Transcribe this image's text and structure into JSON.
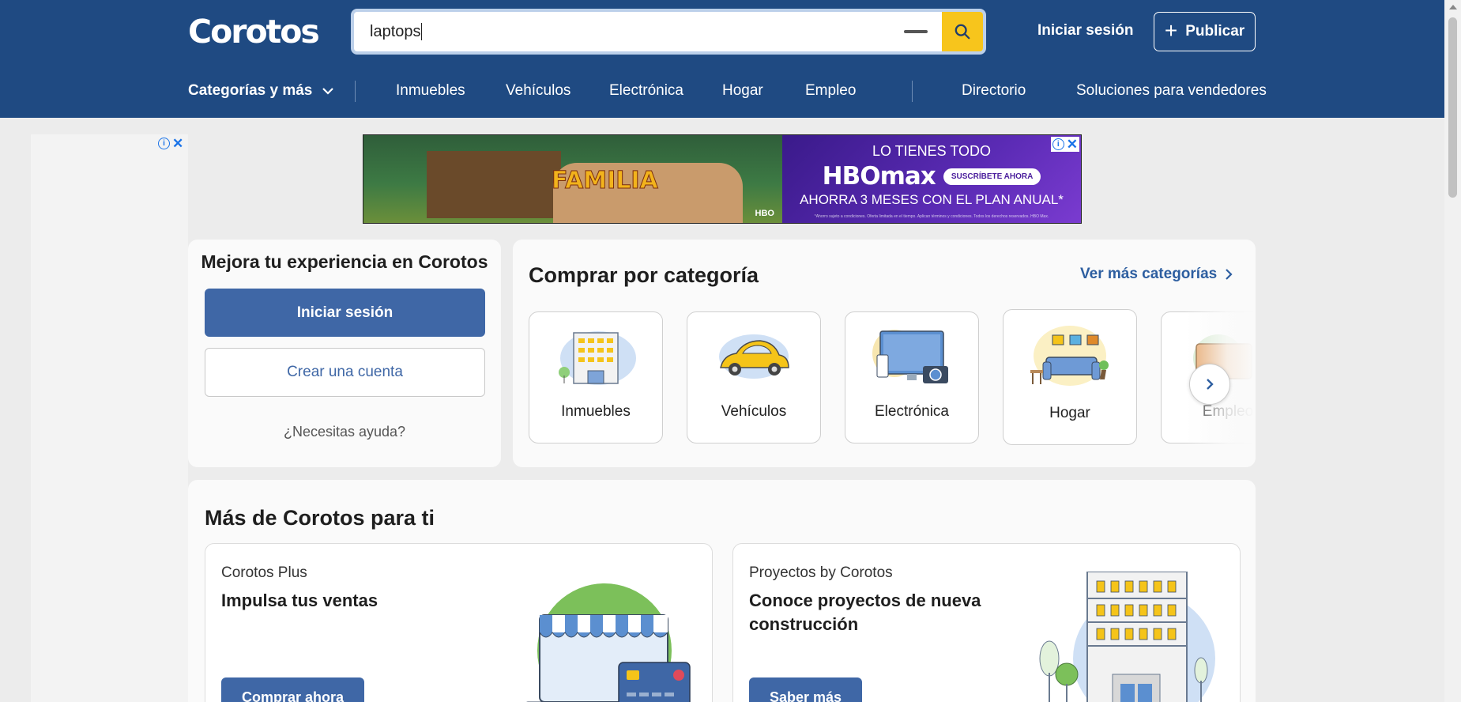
{
  "header": {
    "logo": "Corotos",
    "search": {
      "value": "laptops"
    },
    "login_label": "Iniciar sesión",
    "publish_label": "Publicar",
    "categories_menu_label": "Categorías y más",
    "nav_items": [
      "Inmuebles",
      "Vehículos",
      "Electrónica",
      "Hogar",
      "Empleo"
    ],
    "right_links": [
      "Directorio",
      "Soluciones para vendedores"
    ]
  },
  "ad_banner": {
    "left_title": "FAMILIA",
    "left_brand": "HBO",
    "line1": "LO TIENES TODO",
    "brand": "HBOmax",
    "cta": "SUSCRÍBETE AHORA",
    "line3": "AHORRA 3 MESES CON EL PLAN ANUAL*",
    "fine_print": "*Ahorro sujeto a condiciones. Oferta limitada en el tiempo. Aplican términos y condiciones. Todos los derechos reservados. HBO Max."
  },
  "login_card": {
    "title": "Mejora tu experiencia en Corotos",
    "login_button": "Iniciar sesión",
    "register_button": "Crear una cuenta",
    "help_link": "¿Necesitas ayuda?"
  },
  "categories": {
    "title": "Comprar por categoría",
    "more_link": "Ver más categorías",
    "items": [
      {
        "label": "Inmuebles",
        "icon": "building-icon"
      },
      {
        "label": "Vehículos",
        "icon": "car-icon"
      },
      {
        "label": "Electrónica",
        "icon": "electronics-icon"
      },
      {
        "label": "Hogar",
        "icon": "sofa-icon"
      },
      {
        "label": "Empleo",
        "icon": "briefcase-icon"
      }
    ]
  },
  "more_section": {
    "title": "Más de Corotos para ti",
    "promos": [
      {
        "kicker": "Corotos Plus",
        "headline": "Impulsa tus ventas",
        "cta": "Comprar ahora",
        "icon": "storefront-laptop-icon"
      },
      {
        "kicker": "Proyectos by Corotos",
        "headline": "Conoce proyectos de nueva construcción",
        "cta": "Saber más",
        "icon": "apartment-building-icon"
      }
    ]
  },
  "colors": {
    "header_bg": "#1f4a82",
    "primary_button": "#3f67a6",
    "search_button": "#f7c51c",
    "link": "#2d5ea0"
  }
}
